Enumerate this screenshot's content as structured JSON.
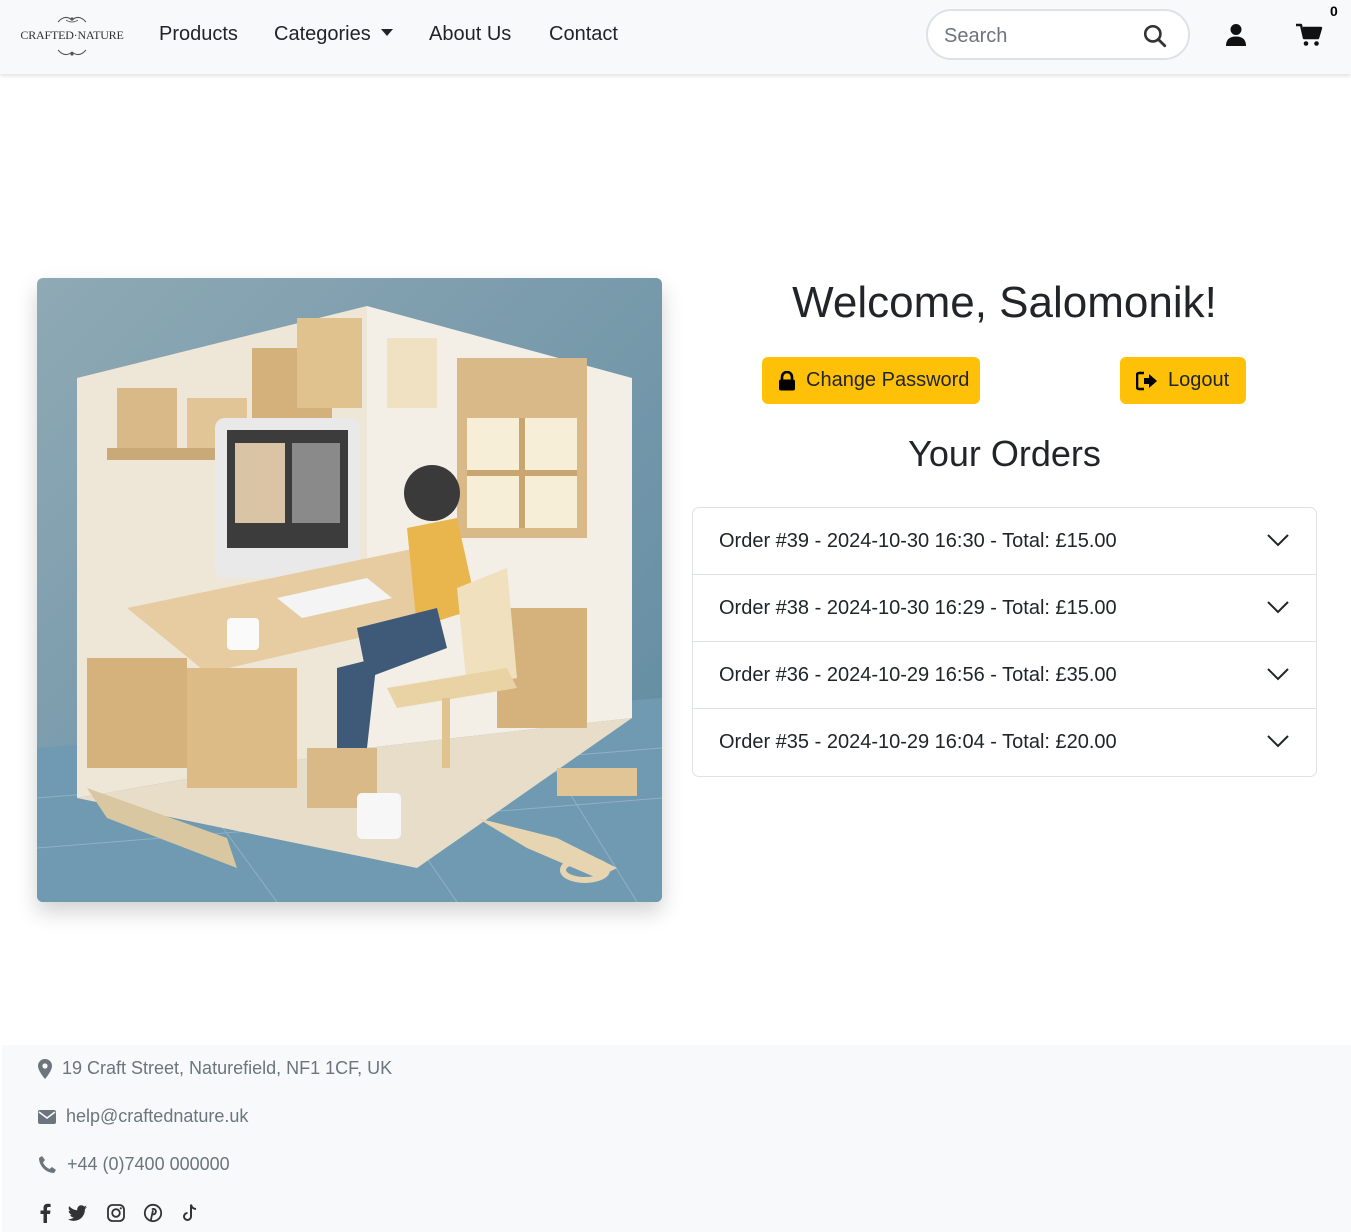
{
  "brand": {
    "logo_text": "CRAFTED·NATURE"
  },
  "nav": {
    "items": [
      {
        "label": "Products"
      },
      {
        "label": "Categories"
      },
      {
        "label": "About Us"
      },
      {
        "label": "Contact"
      }
    ],
    "search": {
      "placeholder": "Search",
      "value": ""
    },
    "cart_count": "0",
    "icons": [
      "search-icon",
      "user-icon",
      "cart-icon"
    ]
  },
  "hero": {
    "image_alt": "Paper-craft illustration of a person working at a desk in a crafting studio"
  },
  "account": {
    "welcome": "Welcome, Salomonik!",
    "change_password_label": "Change Password",
    "logout_label": "Logout",
    "orders_title": "Your Orders",
    "orders": [
      {
        "summary": "Order #39 - 2024-10-30 16:30 - Total: £15.00"
      },
      {
        "summary": "Order #38 - 2024-10-30 16:29 - Total: £15.00"
      },
      {
        "summary": "Order #36 - 2024-10-29 16:56 - Total: £35.00"
      },
      {
        "summary": "Order #35 - 2024-10-29 16:04 - Total: £20.00"
      }
    ]
  },
  "footer": {
    "address": "19 Craft Street, Naturefield, NF1 1CF, UK",
    "email": "help@craftednature.uk",
    "phone": "+44 (0)7400 000000",
    "social": [
      "facebook-icon",
      "twitter-icon",
      "instagram-icon",
      "pinterest-icon",
      "tiktok-icon"
    ]
  },
  "colors": {
    "accent": "#ffc107",
    "navbar_bg": "#f8f9fa",
    "footer_text": "#6c757d",
    "text": "#212529"
  }
}
